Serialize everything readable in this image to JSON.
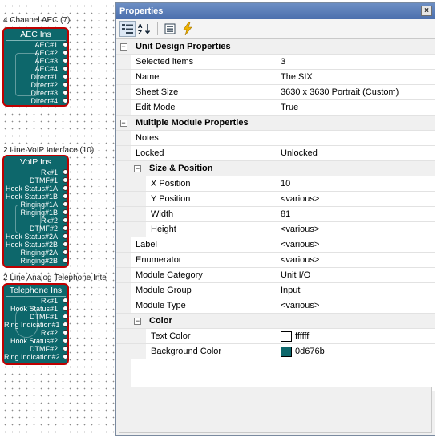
{
  "canvas": {
    "groups": [
      {
        "label": "4 Channel AEC (7)",
        "title": "AEC Ins",
        "ports": [
          "AEC#1",
          "AEC#2",
          "AEC#3",
          "AEC#4",
          "Direct#1",
          "Direct#2",
          "Direct#3",
          "Direct#4"
        ]
      },
      {
        "label": "2 Line VoIP Interface (10)",
        "title": "VoIP Ins",
        "ports": [
          "Rx#1",
          "DTMF#1",
          "Hook Status#1A",
          "Hook Status#1B",
          "Ringing#1A",
          "Ringing#1B",
          "Rx#2",
          "DTMF#2",
          "Hook Status#2A",
          "Hook Status#2B",
          "Ringing#2A",
          "Ringing#2B"
        ]
      },
      {
        "label": "2 Line Analog Telephone Inte",
        "title": "Telephone Ins",
        "ports": [
          "Rx#1",
          "Hook Status#1",
          "DTMF#1",
          "Ring Indication#1",
          "Rx#2",
          "Hook Status#2",
          "DTMF#2",
          "Ring Indication#2"
        ]
      }
    ],
    "module_color": "#0d676b",
    "selection_color": "#c00000"
  },
  "panel": {
    "title": "Properties",
    "close_label": "×",
    "toolbar": [
      "categorized-icon",
      "alphabetical-icon",
      "property-pages-icon",
      "events-icon"
    ],
    "rows": [
      {
        "kind": "cat",
        "name": "Unit Design Properties"
      },
      {
        "name": "Selected items",
        "value": "3"
      },
      {
        "name": "Name",
        "value": "The SIX"
      },
      {
        "name": "Sheet Size",
        "value": "3630 x 3630 Portrait (Custom)"
      },
      {
        "name": "Edit Mode",
        "value": "True"
      },
      {
        "kind": "cat",
        "name": "Multiple Module Properties"
      },
      {
        "name": "Notes",
        "value": ""
      },
      {
        "name": "Locked",
        "value": "Unlocked"
      },
      {
        "kind": "subcat",
        "name": "Size & Position"
      },
      {
        "kind": "sub",
        "name": "X Position",
        "value": "10"
      },
      {
        "kind": "sub",
        "name": "Y Position",
        "value": "<various>"
      },
      {
        "kind": "sub",
        "name": "Width",
        "value": "81"
      },
      {
        "kind": "sub",
        "name": "Height",
        "value": "<various>"
      },
      {
        "name": "Label",
        "value": "<various>"
      },
      {
        "name": "Enumerator",
        "value": "<various>"
      },
      {
        "name": "Module Category",
        "value": "Unit I/O"
      },
      {
        "name": "Module Group",
        "value": "Input"
      },
      {
        "name": "Module Type",
        "value": "<various>"
      },
      {
        "kind": "subcat",
        "name": "Color"
      },
      {
        "kind": "sub",
        "name": "Text Color",
        "value": "ffffff",
        "swatch": "#ffffff"
      },
      {
        "kind": "sub",
        "name": "Background Color",
        "value": "0d676b",
        "swatch": "#0d676b"
      }
    ]
  }
}
